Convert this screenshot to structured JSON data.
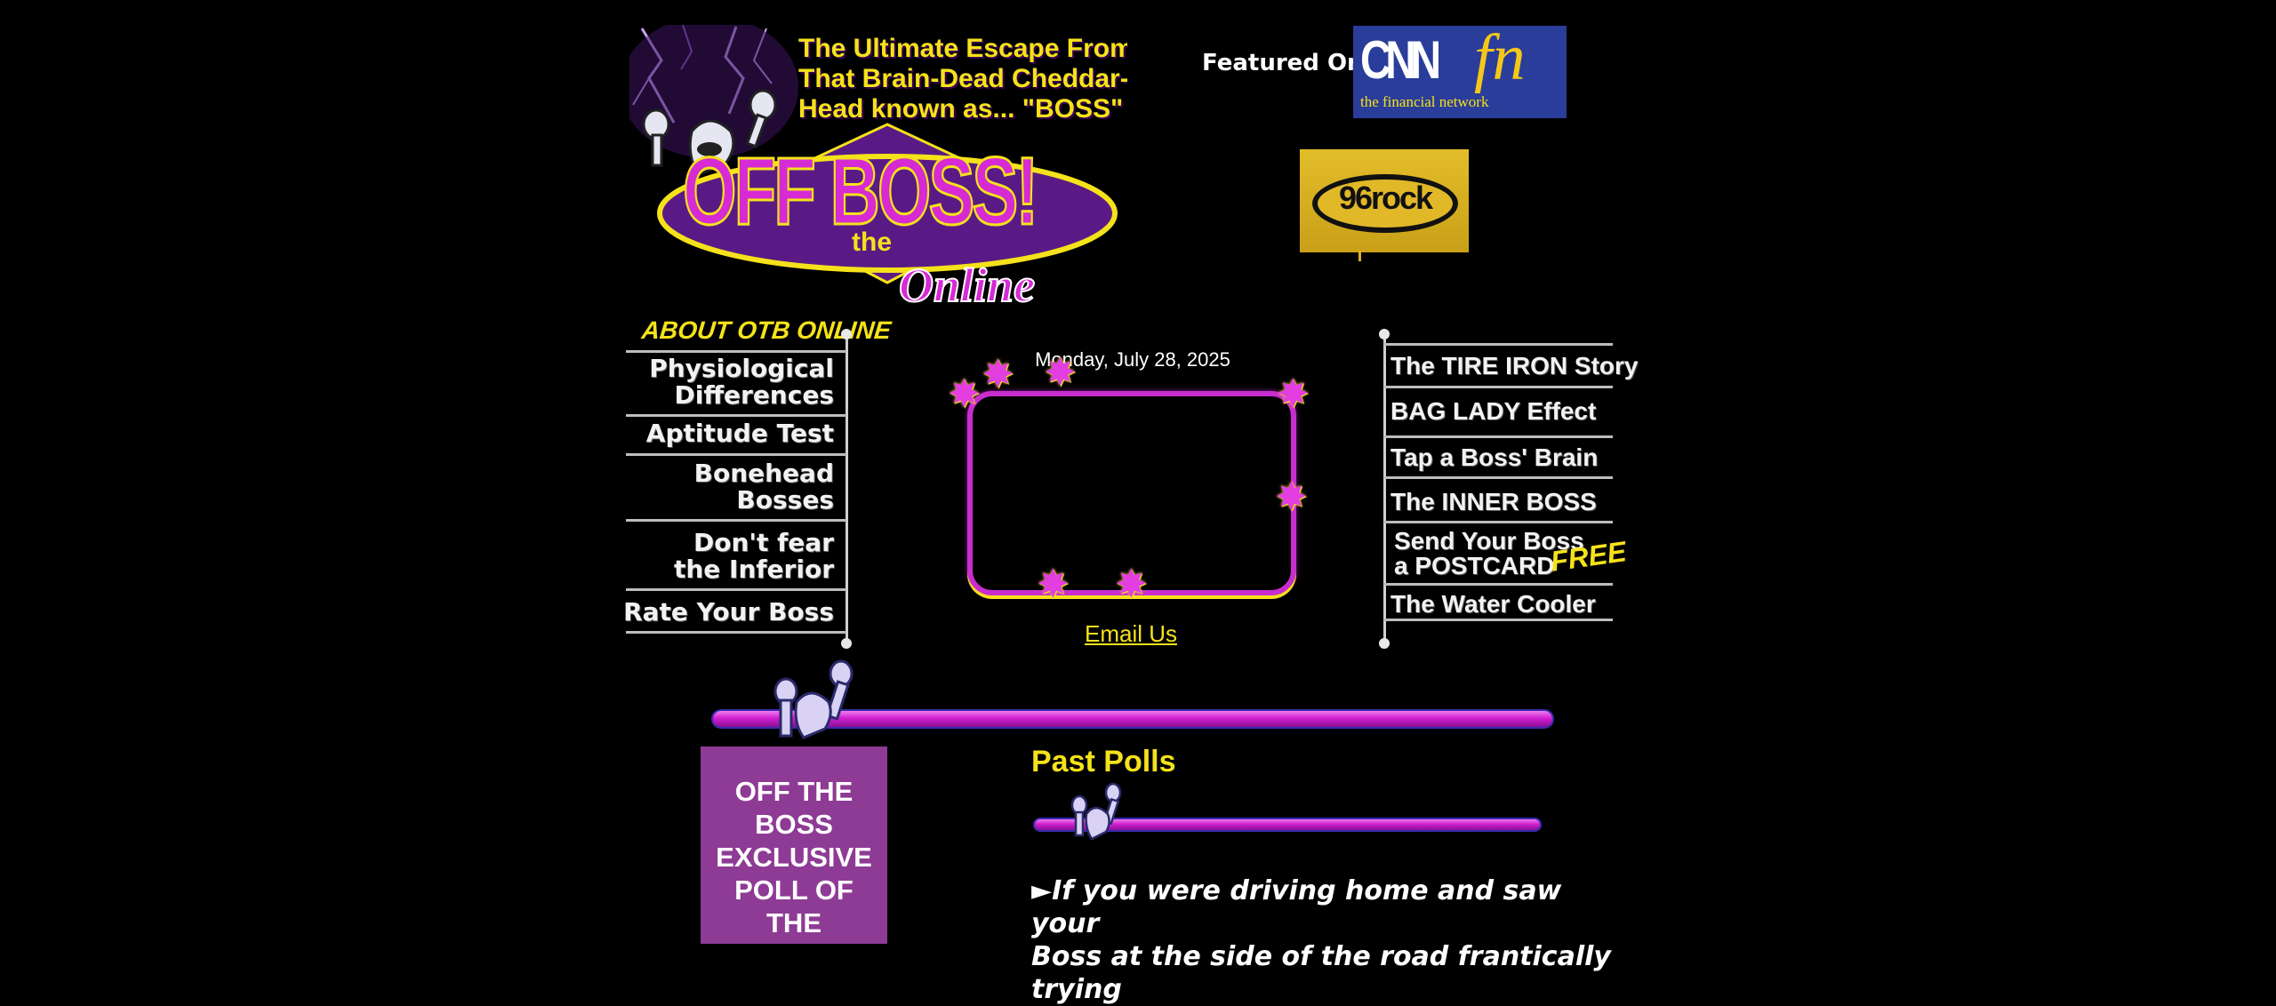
{
  "header": {
    "tagline_lines": [
      "The Ultimate Escape From",
      "That Brain-Dead Cheddar-",
      "Head known as... \"BOSS\""
    ],
    "logo": {
      "main": "OFF BOSS!",
      "the": "the",
      "online": "Online"
    }
  },
  "featured": {
    "label": "Featured On",
    "cnn": {
      "word": "CNN",
      "fn": "fn",
      "subtitle": "the financial network"
    },
    "rock": {
      "text": "96rock"
    }
  },
  "left_nav": {
    "heading": "ABOUT OTB ONLINE",
    "items": [
      {
        "line1": "Physiological",
        "line2": "Differences"
      },
      {
        "line1": "Aptitude Test",
        "line2": ""
      },
      {
        "line1": "Bonehead",
        "line2": "Bosses"
      },
      {
        "line1": "Don't fear",
        "line2": "the Inferior"
      },
      {
        "line1": "Rate Your Boss",
        "line2": ""
      }
    ]
  },
  "center": {
    "date": "Monday, July 28, 2025",
    "email_link": "Email Us"
  },
  "right_nav": {
    "items": [
      {
        "line1": "The TIRE IRON Story",
        "line2": ""
      },
      {
        "line1": "BAG LADY Effect",
        "line2": ""
      },
      {
        "line1": "Tap a Boss' Brain",
        "line2": ""
      },
      {
        "line1": "The INNER BOSS",
        "line2": ""
      },
      {
        "line1": "Send Your Boss",
        "line2": "a POSTCARD"
      },
      {
        "line1": "The Water Cooler",
        "line2": ""
      }
    ],
    "free_tag": "FREE"
  },
  "poll_box": {
    "lines": [
      "OFF THE",
      "BOSS",
      "EXCLUSIVE",
      "POLL OF",
      "THE"
    ]
  },
  "past_polls": {
    "title": "Past Polls",
    "question_marker": "►",
    "question_lines": [
      "If you were driving home and saw your",
      "Boss at the side of the road frantically trying"
    ]
  },
  "colors": {
    "background": "#000000",
    "accent_yellow": "#f5e21a",
    "accent_magenta": "#d020d0",
    "poll_box_purple": "#8e3b95",
    "cnn_blue": "#2a3d9a"
  }
}
